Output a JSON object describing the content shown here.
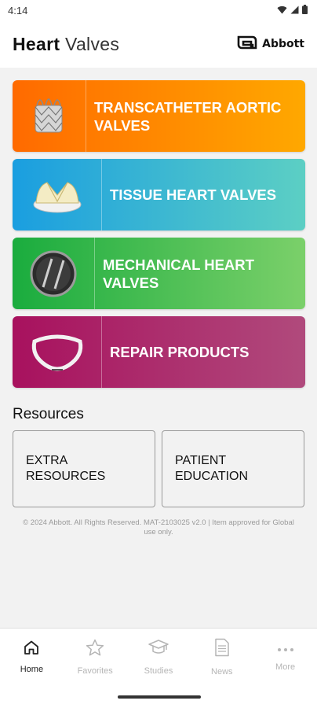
{
  "status_bar": {
    "time": "4:14"
  },
  "header": {
    "title_bold": "Heart",
    "title_light": "Valves",
    "brand": "Abbott"
  },
  "cards": [
    {
      "label": "TRANSCATHETER AORTIC VALVES",
      "icon": "stent-valve-icon",
      "gradient_from": "#ff6a00",
      "gradient_to": "#ffa800"
    },
    {
      "label": "TISSUE HEART VALVES",
      "icon": "tissue-valve-icon",
      "gradient_from": "#1a9ee0",
      "gradient_to": "#5ccfc4"
    },
    {
      "label": "MECHANICAL HEART VALVES",
      "icon": "mechanical-valve-icon",
      "gradient_from": "#1aac3e",
      "gradient_to": "#7bd06a"
    },
    {
      "label": "REPAIR PRODUCTS",
      "icon": "repair-ring-icon",
      "gradient_from": "#a8115e",
      "gradient_to": "#b04a7c"
    }
  ],
  "resources": {
    "title": "Resources",
    "buttons": [
      {
        "label": "EXTRA RESOURCES"
      },
      {
        "label": "PATIENT EDUCATION"
      }
    ]
  },
  "footer": "© 2024 Abbott. All Rights Reserved. MAT-2103025 v2.0 | Item approved for Global use only.",
  "tabs": [
    {
      "label": "Home",
      "icon": "home-icon",
      "active": true
    },
    {
      "label": "Favorites",
      "icon": "star-icon",
      "active": false
    },
    {
      "label": "Studies",
      "icon": "graduation-cap-icon",
      "active": false
    },
    {
      "label": "News",
      "icon": "document-icon",
      "active": false
    },
    {
      "label": "More",
      "icon": "more-dots-icon",
      "active": false
    }
  ]
}
